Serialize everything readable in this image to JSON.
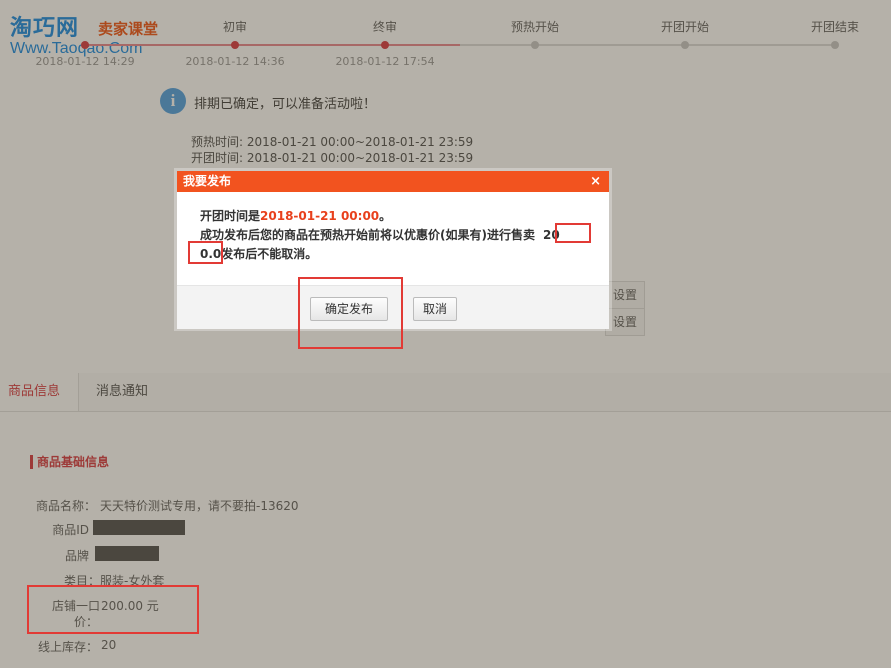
{
  "watermark": {
    "brand": "淘巧网",
    "sub": "卖家课堂",
    "url": "Www.Taoqao.Com"
  },
  "steps": [
    {
      "label": "",
      "time": "2018-01-12 14:29",
      "state": "done"
    },
    {
      "label": "初审",
      "time": "2018-01-12 14:36",
      "state": "done"
    },
    {
      "label": "终审",
      "time": "2018-01-12 17:54",
      "state": "done"
    },
    {
      "label": "预热开始",
      "time": "",
      "state": "pending"
    },
    {
      "label": "开团开始",
      "time": "",
      "state": "pending"
    },
    {
      "label": "开团结束",
      "time": "",
      "state": "pending"
    }
  ],
  "notice": {
    "icon": "info-icon",
    "text": "排期已确定，可以准备活动啦！",
    "preheat": "预热时间: 2018-01-21 00:00~2018-01-21 23:59",
    "group": "开团时间: 2018-01-21 00:00~2018-01-21 23:59"
  },
  "side_buttons": [
    "设置",
    "设置"
  ],
  "tabs": [
    {
      "label": "商品信息",
      "active": true
    },
    {
      "label": "消息通知",
      "active": false
    }
  ],
  "product": {
    "section_title": "商品基础信息",
    "name_label": "商品名称：",
    "name_value": "天天特价测试专用，请不要拍-13620",
    "id_label": "商品ID",
    "brand_label": "品牌",
    "category_label": "类目：",
    "category_value": "服装-女外套",
    "price_label_1": "店铺一口",
    "price_label_2": "价：",
    "price_value": "200.00 元",
    "stock_label": "线上库存：",
    "stock_value": "20"
  },
  "modal": {
    "title": "我要发布",
    "close": "×",
    "line1_prefix": "开团时间是",
    "line1_time": "2018-01-21 00:00",
    "line1_suffix": "。",
    "line2": "成功发布后您的商品在预热开始前将以优惠价(如果有)进行售卖",
    "price_part1": "20",
    "price_part2": "0.0",
    "line3_suffix": "发布后不能取消。",
    "confirm": "确定发布",
    "cancel": "取消"
  },
  "colors": {
    "accent": "#f2531f",
    "brand_red": "#d8404a",
    "annotation": "#e23a35",
    "info": "#55a4e4"
  }
}
